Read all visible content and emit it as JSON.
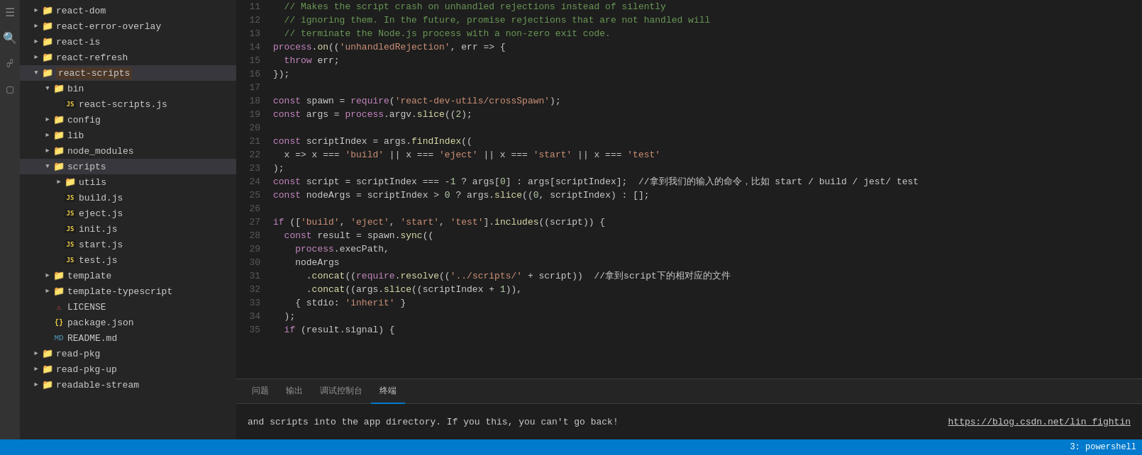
{
  "sidebar": {
    "items": [
      {
        "id": "react-dom",
        "label": "react-dom",
        "type": "folder",
        "level": 1,
        "collapsed": true
      },
      {
        "id": "react-error-overlay",
        "label": "react-error-overlay",
        "type": "folder",
        "level": 1,
        "collapsed": true
      },
      {
        "id": "react-is",
        "label": "react-is",
        "type": "folder",
        "level": 1,
        "collapsed": true
      },
      {
        "id": "react-refresh",
        "label": "react-refresh",
        "type": "folder",
        "level": 1,
        "collapsed": true
      },
      {
        "id": "react-scripts",
        "label": "react-scripts",
        "type": "folder",
        "level": 1,
        "collapsed": false,
        "active": true
      },
      {
        "id": "bin",
        "label": "bin",
        "type": "folder",
        "level": 2,
        "collapsed": false
      },
      {
        "id": "react-scripts.js",
        "label": "react-scripts.js",
        "type": "js",
        "level": 3
      },
      {
        "id": "config",
        "label": "config",
        "type": "folder",
        "level": 2,
        "collapsed": true
      },
      {
        "id": "lib",
        "label": "lib",
        "type": "folder",
        "level": 2,
        "collapsed": true
      },
      {
        "id": "node_modules",
        "label": "node_modules",
        "type": "folder",
        "level": 2,
        "collapsed": true
      },
      {
        "id": "scripts",
        "label": "scripts",
        "type": "folder",
        "level": 2,
        "collapsed": false,
        "active": true
      },
      {
        "id": "utils",
        "label": "utils",
        "type": "folder",
        "level": 3,
        "collapsed": true
      },
      {
        "id": "build.js",
        "label": "build.js",
        "type": "js",
        "level": 3
      },
      {
        "id": "eject.js",
        "label": "eject.js",
        "type": "js",
        "level": 3
      },
      {
        "id": "init.js",
        "label": "init.js",
        "type": "js",
        "level": 3
      },
      {
        "id": "start.js",
        "label": "start.js",
        "type": "js",
        "level": 3
      },
      {
        "id": "test.js",
        "label": "test.js",
        "type": "js",
        "level": 3
      },
      {
        "id": "template",
        "label": "template",
        "type": "folder",
        "level": 2,
        "collapsed": true
      },
      {
        "id": "template-typescript",
        "label": "template-typescript",
        "type": "folder",
        "level": 2,
        "collapsed": true
      },
      {
        "id": "LICENSE",
        "label": "LICENSE",
        "type": "license",
        "level": 2
      },
      {
        "id": "package.json",
        "label": "package.json",
        "type": "json",
        "level": 2
      },
      {
        "id": "README.md",
        "label": "README.md",
        "type": "md",
        "level": 2
      },
      {
        "id": "read-pkg",
        "label": "read-pkg",
        "type": "folder",
        "level": 1,
        "collapsed": true
      },
      {
        "id": "read-pkg-up",
        "label": "read-pkg-up",
        "type": "folder",
        "level": 1,
        "collapsed": true
      },
      {
        "id": "readable-stream",
        "label": "readable-stream",
        "type": "folder",
        "level": 1,
        "collapsed": true
      }
    ]
  },
  "code": {
    "lines": [
      {
        "num": 11,
        "content": "  // Makes the script crash on unhandled rejections instead of silently"
      },
      {
        "num": 12,
        "content": "  // ignoring them. In the future, promise rejections that are not handled will"
      },
      {
        "num": 13,
        "content": "  // terminate the Node.js process with a non-zero exit code."
      },
      {
        "num": 14,
        "content": "process.on('unhandledRejection', err => {"
      },
      {
        "num": 15,
        "content": "  throw err;"
      },
      {
        "num": 16,
        "content": "});"
      },
      {
        "num": 17,
        "content": ""
      },
      {
        "num": 18,
        "content": "const spawn = require('react-dev-utils/crossSpawn');"
      },
      {
        "num": 19,
        "content": "const args = process.argv.slice(2);"
      },
      {
        "num": 20,
        "content": ""
      },
      {
        "num": 21,
        "content": "const scriptIndex = args.findIndex("
      },
      {
        "num": 22,
        "content": "  x => x === 'build' || x === 'eject' || x === 'start' || x === 'test'"
      },
      {
        "num": 23,
        "content": ");"
      },
      {
        "num": 24,
        "content": "const script = scriptIndex === -1 ? args[0] : args[scriptIndex];  //拿到我们的输入的命令，比如 start / build / jest/ test"
      },
      {
        "num": 25,
        "content": "const nodeArgs = scriptIndex > 0 ? args.slice(0, scriptIndex) : [];"
      },
      {
        "num": 26,
        "content": ""
      },
      {
        "num": 27,
        "content": "if (['build', 'eject', 'start', 'test'].includes(script)) {"
      },
      {
        "num": 28,
        "content": "  const result = spawn.sync("
      },
      {
        "num": 29,
        "content": "    process.execPath,"
      },
      {
        "num": 30,
        "content": "    nodeArgs"
      },
      {
        "num": 31,
        "content": "      .concat(require.resolve('../scripts/' + script))  //拿到script下的相对应的文件"
      },
      {
        "num": 32,
        "content": "      .concat(args.slice(scriptIndex + 1)),"
      },
      {
        "num": 33,
        "content": "    { stdio: 'inherit' }"
      },
      {
        "num": 34,
        "content": "  );"
      },
      {
        "num": 35,
        "content": "  if (result.signal) {"
      }
    ]
  },
  "panel": {
    "tabs": [
      {
        "id": "problems",
        "label": "问题"
      },
      {
        "id": "output",
        "label": "输出"
      },
      {
        "id": "debug",
        "label": "调试控制台"
      },
      {
        "id": "terminal",
        "label": "终端",
        "active": true
      }
    ],
    "content": "and scripts into the app directory. If you this, you can't go back!",
    "link": "https://blog.csdn.net/lin_fightin",
    "terminal_label": "3: powershell"
  },
  "statusbar": {
    "right": "3: powershell"
  }
}
